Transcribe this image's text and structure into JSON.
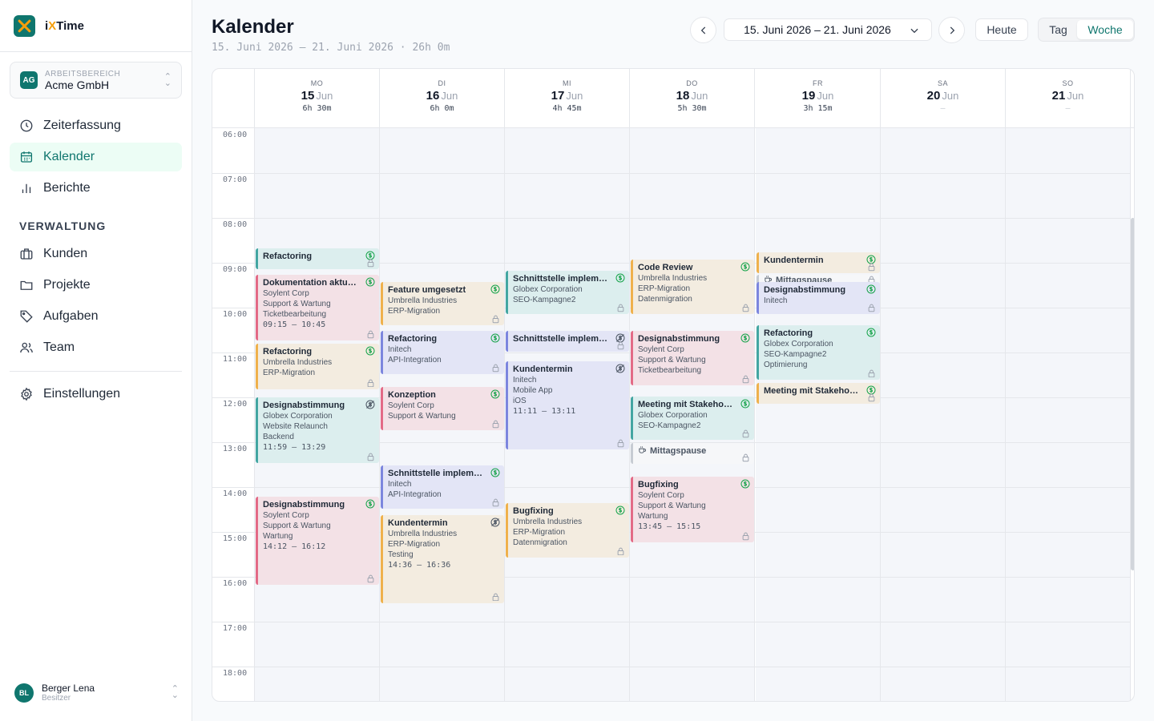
{
  "app": {
    "name_prefix": "i",
    "name_x": "X",
    "name_suffix": "Time",
    "accent": "#0f766e",
    "logo_color": "#f59e0b"
  },
  "workspace": {
    "badge": "AG",
    "label": "ARBEITSBEREICH",
    "name": "Acme GmbH"
  },
  "nav": {
    "zeiterfassung": "Zeiterfassung",
    "kalender": "Kalender",
    "berichte": "Berichte",
    "section": "VERWALTUNG",
    "kunden": "Kunden",
    "projekte": "Projekte",
    "aufgaben": "Aufgaben",
    "team": "Team",
    "einstellungen": "Einstellungen"
  },
  "user": {
    "initials": "BL",
    "name": "Berger Lena",
    "role": "Besitzer"
  },
  "header": {
    "title": "Kalender",
    "subtitle": "15. Juni 2026 – 21. Juni 2026 · 26h 0m",
    "range": "15. Juni 2026 – 21. Juni 2026",
    "today": "Heute",
    "view_day": "Tag",
    "view_week": "Woche"
  },
  "calendar": {
    "days": [
      {
        "dow": "MO",
        "day": "15",
        "month": "Jun",
        "total": "6h 30m"
      },
      {
        "dow": "DI",
        "day": "16",
        "month": "Jun",
        "total": "6h 0m"
      },
      {
        "dow": "MI",
        "day": "17",
        "month": "Jun",
        "total": "4h 45m"
      },
      {
        "dow": "DO",
        "day": "18",
        "month": "Jun",
        "total": "5h 30m"
      },
      {
        "dow": "FR",
        "day": "19",
        "month": "Jun",
        "total": "3h 15m"
      },
      {
        "dow": "SA",
        "day": "20",
        "month": "Jun",
        "total": "–"
      },
      {
        "dow": "SO",
        "day": "21",
        "month": "Jun",
        "total": "–"
      }
    ],
    "hours": [
      "06:00",
      "07:00",
      "08:00",
      "09:00",
      "10:00",
      "11:00",
      "12:00",
      "13:00",
      "14:00",
      "15:00",
      "16:00",
      "17:00",
      "18:00"
    ],
    "events": [
      {
        "day": 0,
        "start": "08:40",
        "end": "09:10",
        "title": "Refactoring",
        "lines": [],
        "color": "teal",
        "icon": "billable"
      },
      {
        "day": 0,
        "start": "09:15",
        "end": "10:45",
        "title": "Dokumentation aktualisieren",
        "lines": [
          "Soylent Corp",
          "Support & Wartung",
          "Ticketbearbeitung"
        ],
        "time": "09:15 – 10:45",
        "color": "pink",
        "icon": "billable"
      },
      {
        "day": 0,
        "start": "10:47",
        "end": "11:50",
        "title": "Refactoring",
        "lines": [
          "Umbrella Industries",
          "ERP-Migration"
        ],
        "color": "amber",
        "icon": "billable"
      },
      {
        "day": 0,
        "start": "11:59",
        "end": "13:29",
        "title": "Designabstimmung",
        "lines": [
          "Globex Corporation",
          "Website Relaunch",
          "Backend"
        ],
        "time": "11:59 – 13:29",
        "color": "teal",
        "icon": "nonbillable"
      },
      {
        "day": 0,
        "start": "14:12",
        "end": "16:12",
        "title": "Designabstimmung",
        "lines": [
          "Soylent Corp",
          "Support & Wartung",
          "Wartung"
        ],
        "time": "14:12 – 16:12",
        "color": "pink",
        "icon": "billable"
      },
      {
        "day": 1,
        "start": "09:25",
        "end": "10:25",
        "title": "Feature umgesetzt",
        "lines": [
          "Umbrella Industries",
          "ERP-Migration"
        ],
        "color": "amber",
        "icon": "billable"
      },
      {
        "day": 1,
        "start": "10:30",
        "end": "11:30",
        "title": "Refactoring",
        "lines": [
          "Initech",
          "API-Integration"
        ],
        "color": "indigo",
        "icon": "billable"
      },
      {
        "day": 1,
        "start": "11:45",
        "end": "12:45",
        "title": "Konzeption",
        "lines": [
          "Soylent Corp",
          "Support & Wartung"
        ],
        "color": "pink",
        "icon": "billable"
      },
      {
        "day": 1,
        "start": "13:30",
        "end": "14:30",
        "title": "Schnittstelle implementieren",
        "lines": [
          "Initech",
          "API-Integration"
        ],
        "color": "indigo",
        "icon": "billable"
      },
      {
        "day": 1,
        "start": "14:36",
        "end": "16:36",
        "title": "Kundentermin",
        "lines": [
          "Umbrella Industries",
          "ERP-Migration",
          "Testing"
        ],
        "time": "14:36 – 16:36",
        "color": "amber",
        "icon": "nonbillable"
      },
      {
        "day": 2,
        "start": "09:10",
        "end": "10:10",
        "title": "Schnittstelle implementieren",
        "lines": [
          "Globex Corporation",
          "SEO-Kampagne2"
        ],
        "color": "teal",
        "icon": "billable"
      },
      {
        "day": 2,
        "start": "10:30",
        "end": "11:00",
        "title": "Schnittstelle implementieren",
        "lines": [],
        "color": "indigo",
        "icon": "nonbillable"
      },
      {
        "day": 2,
        "start": "11:11",
        "end": "13:11",
        "title": "Kundentermin",
        "lines": [
          "Initech",
          "Mobile App",
          "iOS"
        ],
        "time": "11:11 – 13:11",
        "color": "indigo",
        "icon": "nonbillable"
      },
      {
        "day": 2,
        "start": "14:20",
        "end": "15:35",
        "title": "Bugfixing",
        "lines": [
          "Umbrella Industries",
          "ERP-Migration",
          "Datenmigration"
        ],
        "color": "amber",
        "icon": "billable"
      },
      {
        "day": 3,
        "start": "08:55",
        "end": "10:10",
        "title": "Code Review",
        "lines": [
          "Umbrella Industries",
          "ERP-Migration",
          "Datenmigration"
        ],
        "color": "amber",
        "icon": "billable"
      },
      {
        "day": 3,
        "start": "10:30",
        "end": "11:45",
        "title": "Designabstimmung",
        "lines": [
          "Soylent Corp",
          "Support & Wartung",
          "Ticketbearbeitung"
        ],
        "color": "pink",
        "icon": "billable"
      },
      {
        "day": 3,
        "start": "11:58",
        "end": "12:58",
        "title": "Meeting mit Stakeholdern",
        "lines": [
          "Globex Corporation",
          "SEO-Kampagne2"
        ],
        "color": "teal",
        "icon": "billable"
      },
      {
        "day": 3,
        "start": "13:00",
        "end": "13:30",
        "title": "Mittagspause",
        "lines": [],
        "color": "gray",
        "icon": "none",
        "pause": true
      },
      {
        "day": 3,
        "start": "13:45",
        "end": "15:15",
        "title": "Bugfixing",
        "lines": [
          "Soylent Corp",
          "Support & Wartung",
          "Wartung"
        ],
        "time": "13:45 – 15:15",
        "color": "pink",
        "icon": "billable"
      },
      {
        "day": 4,
        "start": "08:45",
        "end": "09:15",
        "title": "Kundentermin",
        "lines": [],
        "color": "amber",
        "icon": "billable"
      },
      {
        "day": 4,
        "start": "09:15",
        "end": "09:25",
        "title": "Mittagspause",
        "lines": [],
        "color": "gray",
        "icon": "none",
        "pause": true
      },
      {
        "day": 4,
        "start": "09:25",
        "end": "10:10",
        "title": "Designabstimmung",
        "lines": [
          "Initech"
        ],
        "color": "indigo",
        "icon": "billable"
      },
      {
        "day": 4,
        "start": "10:22",
        "end": "11:37",
        "title": "Refactoring",
        "lines": [
          "Globex Corporation",
          "SEO-Kampagne2",
          "Optimierung"
        ],
        "color": "teal",
        "icon": "billable"
      },
      {
        "day": 4,
        "start": "11:40",
        "end": "12:10",
        "title": "Meeting mit Stakeholdern",
        "lines": [],
        "color": "amber",
        "icon": "billable"
      }
    ]
  }
}
